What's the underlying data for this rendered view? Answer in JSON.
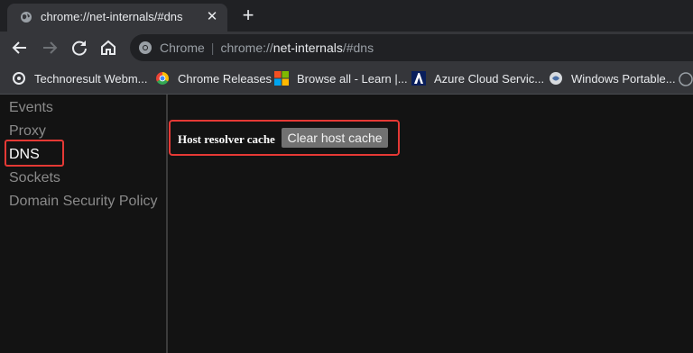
{
  "tab": {
    "title": "chrome://net-internals/#dns",
    "close": "✕"
  },
  "newtab": "+",
  "omnibox": {
    "site": "Chrome",
    "separator": "|",
    "url_scheme": "chrome://",
    "url_host": "net-internals",
    "url_path": "/#dns"
  },
  "bookmarks": [
    {
      "label": "Technoresult Webm...",
      "icon": "settings-icon"
    },
    {
      "label": "Chrome Releases",
      "icon": "chrome-logo-icon"
    },
    {
      "label": "Browse all - Learn |...",
      "icon": "microsoft-logo-icon"
    },
    {
      "label": "Azure Cloud Servic...",
      "icon": "azure-logo-icon"
    },
    {
      "label": "Windows Portable...",
      "icon": "windows-portable-icon"
    }
  ],
  "sidebar": {
    "items": [
      {
        "label": "Events"
      },
      {
        "label": "Proxy"
      },
      {
        "label": "DNS"
      },
      {
        "label": "Sockets"
      },
      {
        "label": "Domain Security Policy"
      }
    ]
  },
  "dns": {
    "label": "Host resolver cache",
    "button": "Clear host cache"
  },
  "colors": {
    "highlight": "#e53935",
    "button_bg": "#717171",
    "content_bg": "#131313"
  }
}
